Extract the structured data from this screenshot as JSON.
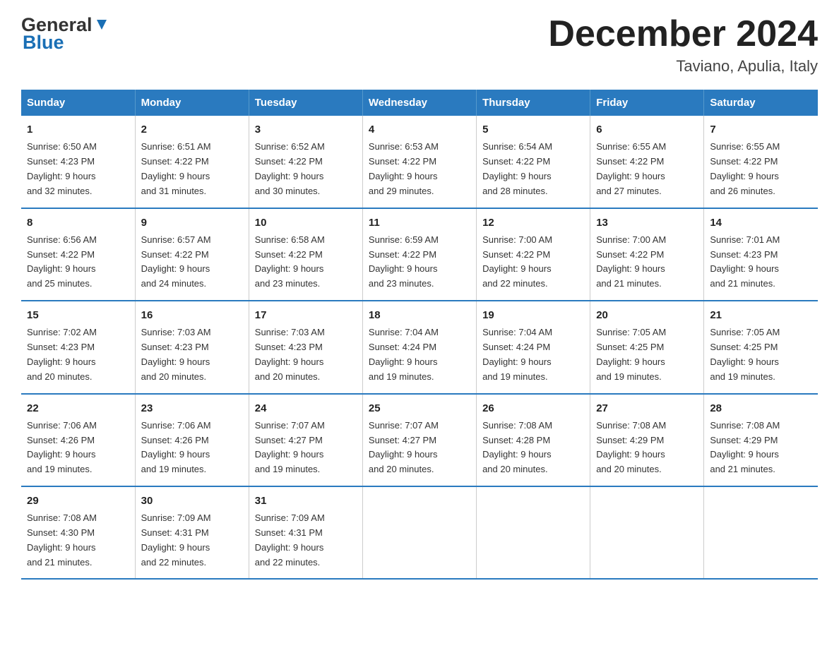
{
  "header": {
    "logo_general": "General",
    "logo_blue": "Blue",
    "month_year": "December 2024",
    "location": "Taviano, Apulia, Italy"
  },
  "weekdays": [
    "Sunday",
    "Monday",
    "Tuesday",
    "Wednesday",
    "Thursday",
    "Friday",
    "Saturday"
  ],
  "weeks": [
    [
      {
        "day": "1",
        "sunrise": "6:50 AM",
        "sunset": "4:23 PM",
        "daylight": "9 hours and 32 minutes."
      },
      {
        "day": "2",
        "sunrise": "6:51 AM",
        "sunset": "4:22 PM",
        "daylight": "9 hours and 31 minutes."
      },
      {
        "day": "3",
        "sunrise": "6:52 AM",
        "sunset": "4:22 PM",
        "daylight": "9 hours and 30 minutes."
      },
      {
        "day": "4",
        "sunrise": "6:53 AM",
        "sunset": "4:22 PM",
        "daylight": "9 hours and 29 minutes."
      },
      {
        "day": "5",
        "sunrise": "6:54 AM",
        "sunset": "4:22 PM",
        "daylight": "9 hours and 28 minutes."
      },
      {
        "day": "6",
        "sunrise": "6:55 AM",
        "sunset": "4:22 PM",
        "daylight": "9 hours and 27 minutes."
      },
      {
        "day": "7",
        "sunrise": "6:55 AM",
        "sunset": "4:22 PM",
        "daylight": "9 hours and 26 minutes."
      }
    ],
    [
      {
        "day": "8",
        "sunrise": "6:56 AM",
        "sunset": "4:22 PM",
        "daylight": "9 hours and 25 minutes."
      },
      {
        "day": "9",
        "sunrise": "6:57 AM",
        "sunset": "4:22 PM",
        "daylight": "9 hours and 24 minutes."
      },
      {
        "day": "10",
        "sunrise": "6:58 AM",
        "sunset": "4:22 PM",
        "daylight": "9 hours and 23 minutes."
      },
      {
        "day": "11",
        "sunrise": "6:59 AM",
        "sunset": "4:22 PM",
        "daylight": "9 hours and 23 minutes."
      },
      {
        "day": "12",
        "sunrise": "7:00 AM",
        "sunset": "4:22 PM",
        "daylight": "9 hours and 22 minutes."
      },
      {
        "day": "13",
        "sunrise": "7:00 AM",
        "sunset": "4:22 PM",
        "daylight": "9 hours and 21 minutes."
      },
      {
        "day": "14",
        "sunrise": "7:01 AM",
        "sunset": "4:23 PM",
        "daylight": "9 hours and 21 minutes."
      }
    ],
    [
      {
        "day": "15",
        "sunrise": "7:02 AM",
        "sunset": "4:23 PM",
        "daylight": "9 hours and 20 minutes."
      },
      {
        "day": "16",
        "sunrise": "7:03 AM",
        "sunset": "4:23 PM",
        "daylight": "9 hours and 20 minutes."
      },
      {
        "day": "17",
        "sunrise": "7:03 AM",
        "sunset": "4:23 PM",
        "daylight": "9 hours and 20 minutes."
      },
      {
        "day": "18",
        "sunrise": "7:04 AM",
        "sunset": "4:24 PM",
        "daylight": "9 hours and 19 minutes."
      },
      {
        "day": "19",
        "sunrise": "7:04 AM",
        "sunset": "4:24 PM",
        "daylight": "9 hours and 19 minutes."
      },
      {
        "day": "20",
        "sunrise": "7:05 AM",
        "sunset": "4:25 PM",
        "daylight": "9 hours and 19 minutes."
      },
      {
        "day": "21",
        "sunrise": "7:05 AM",
        "sunset": "4:25 PM",
        "daylight": "9 hours and 19 minutes."
      }
    ],
    [
      {
        "day": "22",
        "sunrise": "7:06 AM",
        "sunset": "4:26 PM",
        "daylight": "9 hours and 19 minutes."
      },
      {
        "day": "23",
        "sunrise": "7:06 AM",
        "sunset": "4:26 PM",
        "daylight": "9 hours and 19 minutes."
      },
      {
        "day": "24",
        "sunrise": "7:07 AM",
        "sunset": "4:27 PM",
        "daylight": "9 hours and 19 minutes."
      },
      {
        "day": "25",
        "sunrise": "7:07 AM",
        "sunset": "4:27 PM",
        "daylight": "9 hours and 20 minutes."
      },
      {
        "day": "26",
        "sunrise": "7:08 AM",
        "sunset": "4:28 PM",
        "daylight": "9 hours and 20 minutes."
      },
      {
        "day": "27",
        "sunrise": "7:08 AM",
        "sunset": "4:29 PM",
        "daylight": "9 hours and 20 minutes."
      },
      {
        "day": "28",
        "sunrise": "7:08 AM",
        "sunset": "4:29 PM",
        "daylight": "9 hours and 21 minutes."
      }
    ],
    [
      {
        "day": "29",
        "sunrise": "7:08 AM",
        "sunset": "4:30 PM",
        "daylight": "9 hours and 21 minutes."
      },
      {
        "day": "30",
        "sunrise": "7:09 AM",
        "sunset": "4:31 PM",
        "daylight": "9 hours and 22 minutes."
      },
      {
        "day": "31",
        "sunrise": "7:09 AM",
        "sunset": "4:31 PM",
        "daylight": "9 hours and 22 minutes."
      },
      null,
      null,
      null,
      null
    ]
  ],
  "labels": {
    "sunrise": "Sunrise:",
    "sunset": "Sunset:",
    "daylight": "Daylight:"
  }
}
